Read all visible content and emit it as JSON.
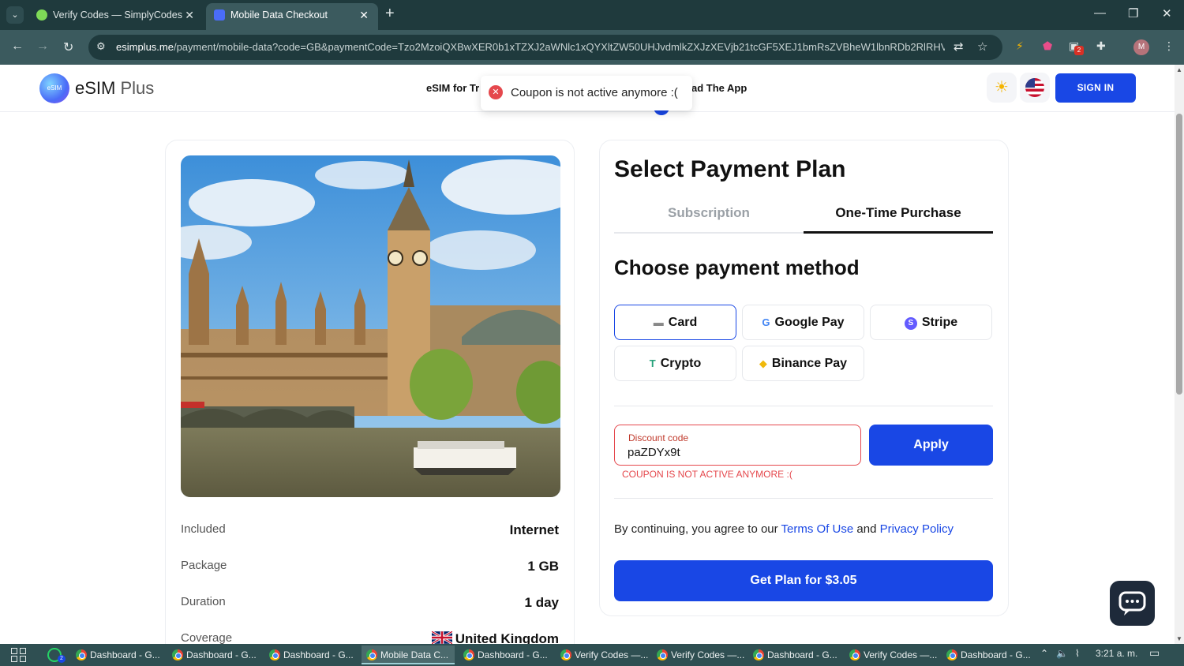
{
  "browser": {
    "tabs": [
      {
        "title": "Verify Codes — SimplyCodes",
        "active": false
      },
      {
        "title": "Mobile Data Checkout",
        "active": true
      }
    ],
    "url_host": "esimplus.me",
    "url_path": "/payment/mobile-data?code=GB&paymentCode=Tzo2MzoiQXBwXER0b1xTZXJ2aWNlc1xQYXltZW50UHJvdmlkZXJzXEVjb21tcGF5XEJ1bmRsZVBheW1lbnRDb2RlRHVlj...",
    "extension_badge": "2",
    "profile_initial": "M"
  },
  "header": {
    "brand": "eSIM",
    "brand_suffix": "Plus",
    "logo_text": "eSIM",
    "nav_left": "eSIM for Tr",
    "nav_right": "ad The App",
    "signin": "SIGN IN"
  },
  "toast": {
    "message": "Coupon is not active anymore :("
  },
  "plan_details": [
    {
      "label": "Included",
      "value": "Internet"
    },
    {
      "label": "Package",
      "value": "1 GB"
    },
    {
      "label": "Duration",
      "value": "1 day"
    },
    {
      "label": "Coverage",
      "value": "United Kingdom"
    }
  ],
  "payment": {
    "title": "Select Payment Plan",
    "tabs": [
      "Subscription",
      "One-Time Purchase"
    ],
    "active_tab": "One-Time Purchase",
    "method_title": "Choose payment method",
    "methods": [
      {
        "label": "Card",
        "icon": "card-icon",
        "selected": true
      },
      {
        "label": "Google Pay",
        "icon": "google-icon",
        "selected": false
      },
      {
        "label": "Stripe",
        "icon": "stripe-icon",
        "selected": false
      },
      {
        "label": "Crypto",
        "icon": "tether-icon",
        "selected": false
      },
      {
        "label": "Binance Pay",
        "icon": "binance-icon",
        "selected": false
      }
    ],
    "discount_label": "Discount code",
    "discount_value": "paZDYx9t",
    "apply_label": "Apply",
    "discount_error": "COUPON IS NOT ACTIVE ANYMORE :(",
    "terms_prefix": "By continuing, you agree to our",
    "terms_link": "Terms Of Use",
    "terms_and": "and",
    "privacy_link": "Privacy Policy",
    "cta": "Get Plan for $3.05"
  },
  "taskbar": {
    "items": [
      {
        "label": "Dashboard - G...",
        "active": false
      },
      {
        "label": "Dashboard - G...",
        "active": false
      },
      {
        "label": "Dashboard - G...",
        "active": false
      },
      {
        "label": "Mobile Data C...",
        "active": true
      },
      {
        "label": "Dashboard - G...",
        "active": false
      },
      {
        "label": "Verify Codes —...",
        "active": false
      },
      {
        "label": "Verify Codes —...",
        "active": false
      },
      {
        "label": "Dashboard - G...",
        "active": false
      },
      {
        "label": "Verify Codes —...",
        "active": false
      },
      {
        "label": "Dashboard - G...",
        "active": false
      }
    ],
    "whatsapp_badge": "2",
    "time": "3:21 a. m."
  },
  "colors": {
    "primary": "#1947e5",
    "error": "#e5484d",
    "chrome": "#3b5a5e"
  }
}
